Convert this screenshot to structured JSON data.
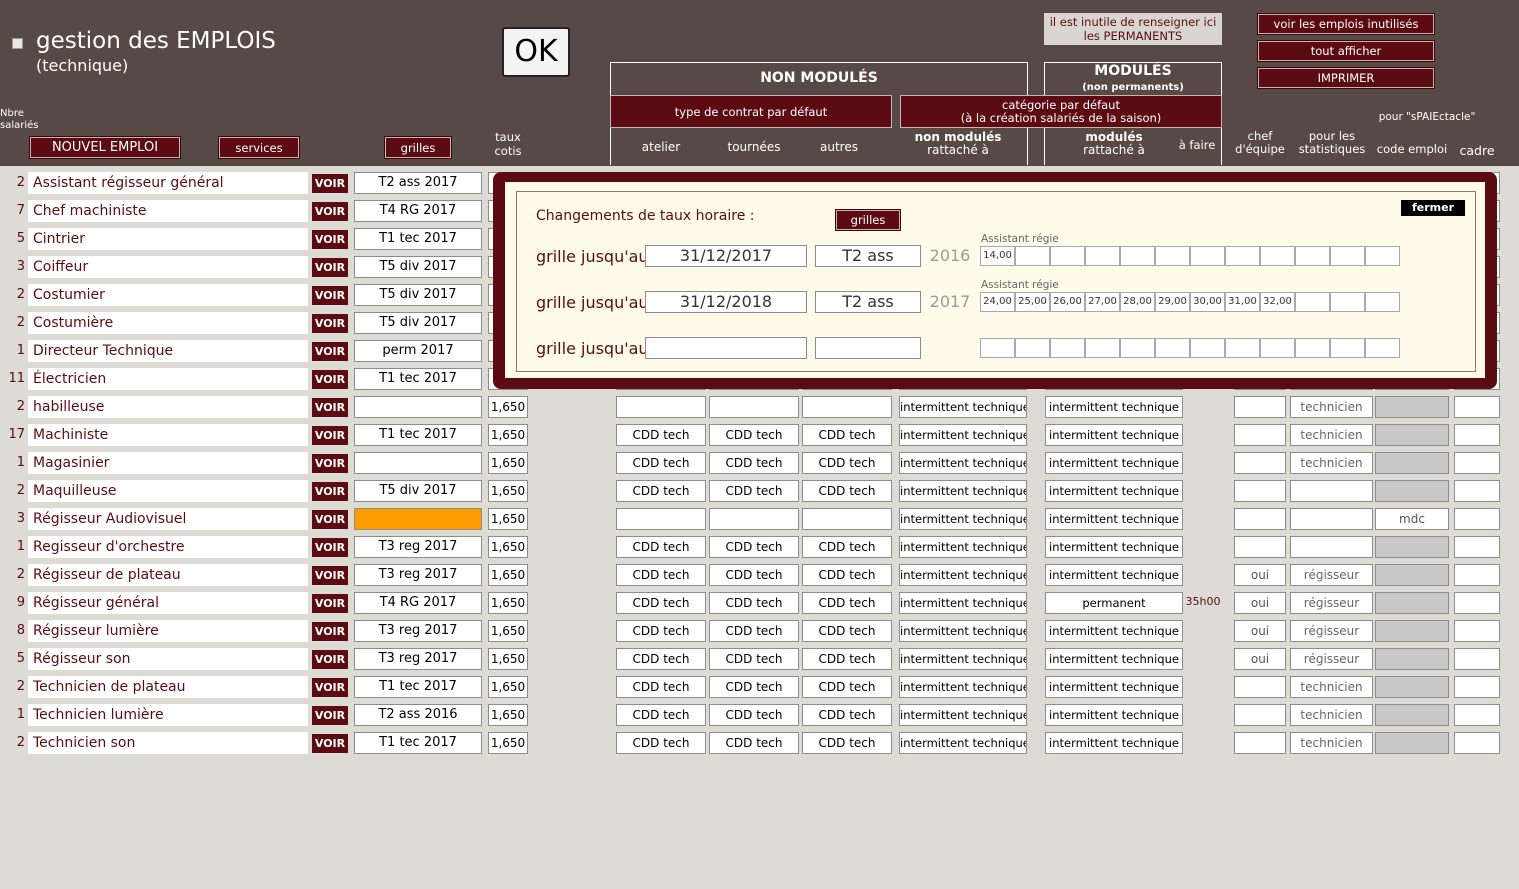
{
  "header": {
    "title": "gestion des EMPLOIS",
    "subtitle": "(technique)",
    "ok_label": "OK",
    "note": "il est inutile de renseigner ici les PERMANENTS",
    "btn_unused": "voir les emplois inutilisés",
    "btn_show_all": "tout afficher",
    "btn_print": "IMPRIMER",
    "nbre_label": "Nbre salariés",
    "btn_new": "NOUVEL EMPLOI",
    "btn_services": "services",
    "btn_grilles": "grilles",
    "taux_label": "taux cotis",
    "non_modules": "NON MODULÉS",
    "modules": "MODULÉS",
    "modules_sub": "(non permanents)",
    "type_contrat": "type de contrat par défaut",
    "categorie": "catégorie par défaut",
    "categorie_sub": "(à la création salariés de la saison)",
    "atelier": "atelier",
    "tournees": "tournées",
    "autres": "autres",
    "nonmod_rattache": "non modulés",
    "rattache": "rattaché à",
    "mod_rattache": "modulés",
    "rattache2": "rattaché à",
    "a_faire": "à faire",
    "chef": "chef d'équipe",
    "stats": "pour les statistiques",
    "pour": "pour \"sPAIEctacle\"",
    "code_emploi": "code emploi",
    "cadre": "cadre"
  },
  "rows": [
    {
      "count": "2",
      "name": "Assistant régisseur général",
      "grille": "T2 ass 2017",
      "taux": "",
      "a": "",
      "b": "",
      "c": "",
      "nm": "",
      "mod": "",
      "faire": "",
      "chef": "",
      "stat": "",
      "code": ""
    },
    {
      "count": "7",
      "name": "Chef machiniste",
      "grille": "T4 RG 2017",
      "taux": "",
      "a": "",
      "b": "",
      "c": "",
      "nm": "",
      "mod": "",
      "faire": "",
      "chef": "",
      "stat": "",
      "code": ""
    },
    {
      "count": "5",
      "name": "Cintrier",
      "grille": "T1 tec 2017",
      "taux": "",
      "a": "",
      "b": "",
      "c": "",
      "nm": "",
      "mod": "",
      "faire": "",
      "chef": "",
      "stat": "",
      "code": ""
    },
    {
      "count": "3",
      "name": "Coiffeur",
      "grille": "T5 div 2017",
      "taux": "",
      "a": "",
      "b": "",
      "c": "",
      "nm": "",
      "mod": "",
      "faire": "",
      "chef": "",
      "stat": "",
      "code": ""
    },
    {
      "count": "2",
      "name": "Costumier",
      "grille": "T5 div 2017",
      "taux": "",
      "a": "",
      "b": "",
      "c": "",
      "nm": "",
      "mod": "",
      "faire": "",
      "chef": "",
      "stat": "",
      "code": ""
    },
    {
      "count": "2",
      "name": "Costumière",
      "grille": "T5 div 2017",
      "taux": "",
      "a": "",
      "b": "",
      "c": "",
      "nm": "",
      "mod": "",
      "faire": "",
      "chef": "",
      "stat": "",
      "code": ""
    },
    {
      "count": "1",
      "name": "Directeur Technique",
      "grille": "perm 2017",
      "taux": "",
      "a": "",
      "b": "",
      "c": "",
      "nm": "",
      "mod": "",
      "faire": "",
      "chef": "",
      "stat": "",
      "code": ""
    },
    {
      "count": "11",
      "name": "Électricien",
      "grille": "T1 tec 2017",
      "taux": "",
      "a": "",
      "b": "",
      "c": "",
      "nm": "",
      "mod": "",
      "faire": "",
      "chef": "",
      "stat": "",
      "code": ""
    },
    {
      "count": "2",
      "name": "habilleuse",
      "grille": "",
      "taux": "1,650",
      "a": "",
      "b": "",
      "c": "",
      "nm": "intermittent technique",
      "mod": "intermittent technique",
      "faire": "",
      "chef": "",
      "stat": "technicien",
      "code": ""
    },
    {
      "count": "17",
      "name": "Machiniste",
      "grille": "T1 tec 2017",
      "taux": "1,650",
      "a": "CDD tech",
      "b": "CDD tech",
      "c": "CDD tech",
      "nm": "intermittent technique",
      "mod": "intermittent technique",
      "faire": "",
      "chef": "",
      "stat": "technicien",
      "code": ""
    },
    {
      "count": "1",
      "name": "Magasinier",
      "grille": "",
      "taux": "1,650",
      "a": "CDD tech",
      "b": "CDD tech",
      "c": "CDD tech",
      "nm": "intermittent technique",
      "mod": "intermittent technique",
      "faire": "",
      "chef": "",
      "stat": "technicien",
      "code": ""
    },
    {
      "count": "2",
      "name": "Maquilleuse",
      "grille": "T5 div 2017",
      "taux": "1,650",
      "a": "CDD tech",
      "b": "CDD tech",
      "c": "CDD tech",
      "nm": "intermittent technique",
      "mod": "intermittent technique",
      "faire": "",
      "chef": "",
      "stat": "",
      "code": ""
    },
    {
      "count": "3",
      "name": "Régisseur Audiovisuel",
      "grille": "",
      "taux": "1,650",
      "a": "",
      "b": "",
      "c": "",
      "nm": "intermittent technique",
      "mod": "intermittent technique",
      "faire": "",
      "chef": "",
      "stat": "",
      "code": "mdc",
      "orange": true
    },
    {
      "count": "1",
      "name": "Regisseur d'orchestre",
      "grille": "T3 reg 2017",
      "taux": "1,650",
      "a": "CDD tech",
      "b": "CDD tech",
      "c": "CDD tech",
      "nm": "intermittent technique",
      "mod": "intermittent technique",
      "faire": "",
      "chef": "",
      "stat": "",
      "code": ""
    },
    {
      "count": "2",
      "name": "Régisseur de plateau",
      "grille": "T3 reg 2017",
      "taux": "1,650",
      "a": "CDD tech",
      "b": "CDD tech",
      "c": "CDD tech",
      "nm": "intermittent technique",
      "mod": "intermittent technique",
      "faire": "",
      "chef": "oui",
      "stat": "régisseur",
      "code": ""
    },
    {
      "count": "9",
      "name": "Régisseur général",
      "grille": "T4 RG 2017",
      "taux": "1,650",
      "a": "CDD tech",
      "b": "CDD tech",
      "c": "CDD tech",
      "nm": "intermittent technique",
      "mod": "permanent",
      "faire": "35h00",
      "chef": "oui",
      "stat": "régisseur",
      "code": ""
    },
    {
      "count": "8",
      "name": "Régisseur lumière",
      "grille": "T3 reg 2017",
      "taux": "1,650",
      "a": "CDD tech",
      "b": "CDD tech",
      "c": "CDD tech",
      "nm": "intermittent technique",
      "mod": "intermittent technique",
      "faire": "",
      "chef": "oui",
      "stat": "régisseur",
      "code": ""
    },
    {
      "count": "5",
      "name": "Régisseur son",
      "grille": "T3 reg 2017",
      "taux": "1,650",
      "a": "CDD tech",
      "b": "CDD tech",
      "c": "CDD tech",
      "nm": "intermittent technique",
      "mod": "intermittent technique",
      "faire": "",
      "chef": "oui",
      "stat": "régisseur",
      "code": ""
    },
    {
      "count": "2",
      "name": "Technicien de plateau",
      "grille": "T1 tec 2017",
      "taux": "1,650",
      "a": "CDD tech",
      "b": "CDD tech",
      "c": "CDD tech",
      "nm": "intermittent technique",
      "mod": "intermittent technique",
      "faire": "",
      "chef": "",
      "stat": "technicien",
      "code": ""
    },
    {
      "count": "1",
      "name": "Technicien lumière",
      "grille": "T2 ass 2016",
      "taux": "1,650",
      "a": "CDD tech",
      "b": "CDD tech",
      "c": "CDD tech",
      "nm": "intermittent technique",
      "mod": "intermittent technique",
      "faire": "",
      "chef": "",
      "stat": "technicien",
      "code": ""
    },
    {
      "count": "2",
      "name": "Technicien son",
      "grille": "T1 tec 2017",
      "taux": "1,650",
      "a": "CDD tech",
      "b": "CDD tech",
      "c": "CDD tech",
      "nm": "intermittent technique",
      "mod": "intermittent technique",
      "faire": "",
      "chef": "",
      "stat": "technicien",
      "code": ""
    }
  ],
  "row_labels": {
    "voir": "VOIR"
  },
  "popup": {
    "title": "Changements de taux horaire :",
    "btn_grilles": "grilles",
    "btn_close": "fermer",
    "lines": [
      {
        "label": "grille jusqu'au",
        "date": "31/12/2017",
        "grille": "T2 ass",
        "year": "2016",
        "cat": "Assistant régie",
        "values": [
          "14,00",
          "",
          "",
          "",
          "",
          "",
          "",
          "",
          "",
          "",
          "",
          ""
        ]
      },
      {
        "label": "grille jusqu'au",
        "date": "31/12/2018",
        "grille": "T2 ass",
        "year": "2017",
        "cat": "Assistant régie",
        "values": [
          "24,00",
          "25,00",
          "26,00",
          "27,00",
          "28,00",
          "29,00",
          "30,00",
          "31,00",
          "32,00",
          "",
          "",
          ""
        ]
      },
      {
        "label": "grille jusqu'au",
        "date": "",
        "grille": "",
        "year": "",
        "cat": "",
        "values": [
          "",
          "",
          "",
          "",
          "",
          "",
          "",
          "",
          "",
          "",
          "",
          ""
        ]
      }
    ]
  },
  "colors": {
    "header_bg": "#574a46",
    "accent": "#5c0b12",
    "orange": "#ff9d00",
    "body_bg": "#dcdcd5"
  }
}
